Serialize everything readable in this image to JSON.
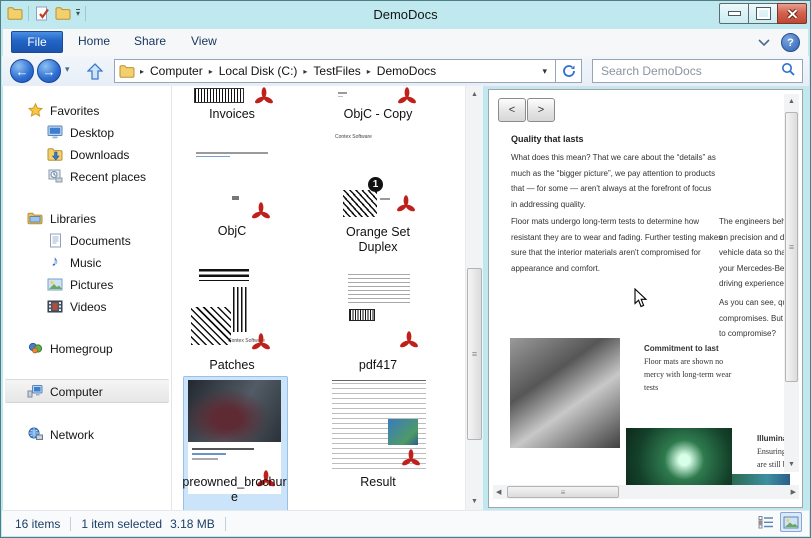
{
  "window": {
    "title": "DemoDocs"
  },
  "icons": {
    "breadcrumb_arrow": "▸",
    "dropdown_arrow": "▾",
    "back_arrow": "←",
    "forward_arrow": "→",
    "scroll_up": "▲",
    "scroll_down": "▼",
    "scroll_left": "◀",
    "scroll_right": "▶",
    "grip": "≡",
    "music_note": "♪",
    "help": "?",
    "close": "✕"
  },
  "ribbon": {
    "tabs": [
      "File",
      "Home",
      "Share",
      "View"
    ]
  },
  "navbar": {
    "breadcrumb": [
      "Computer",
      "Local Disk (C:)",
      "TestFiles",
      "DemoDocs"
    ],
    "search_placeholder": "Search DemoDocs"
  },
  "sidebar": {
    "items": [
      {
        "label": "Favorites"
      },
      {
        "label": "Desktop"
      },
      {
        "label": "Downloads"
      },
      {
        "label": "Recent places"
      },
      {
        "label": "Libraries"
      },
      {
        "label": "Documents"
      },
      {
        "label": "Music"
      },
      {
        "label": "Pictures"
      },
      {
        "label": "Videos"
      },
      {
        "label": "Homegroup"
      },
      {
        "label": "Computer",
        "selected": true
      },
      {
        "label": "Network"
      }
    ]
  },
  "files": {
    "items": [
      {
        "name": "Invoices"
      },
      {
        "name": "ObjC - Copy"
      },
      {
        "name": "ObjC"
      },
      {
        "name": "Orange Set Duplex",
        "badge": "1",
        "thumb_text": "Contex Software"
      },
      {
        "name": "Patches",
        "thumb_text": "Contex Software"
      },
      {
        "name": "pdf417"
      },
      {
        "name": "preowned_brochure",
        "selected": true
      },
      {
        "name": "Result"
      }
    ]
  },
  "preview": {
    "prev": "<",
    "next": ">",
    "heading": "Quality that lasts",
    "para1": "What does this mean? That we care about the “details” as much as the “bigger picture”, we pay attention to products that — for some — aren't always at the forefront of focus in addressing quality.",
    "para2": "Floor mats undergo long-term tests to determine how resistant they are to wear and fading. Further testing makes sure that the interior materials aren't compromised for appearance and comfort.",
    "col2a": [
      "The engineers behin",
      "on precision and de",
      "vehicle data so that",
      "your Mercedes-Ben",
      "driving experience."
    ],
    "col2b": [
      "As you can see, qua",
      "compromises. But w",
      "to compromise?"
    ],
    "caption1_title": "Commitment to last",
    "caption1_body": "Floor mats are shown no mercy with long-term wear tests",
    "caption2_title": "Illuminatin",
    "caption2_lines": [
      "Ensuring t",
      "are still bl"
    ]
  },
  "statusbar": {
    "count": "16 items",
    "selected": "1 item selected",
    "size": "3.18 MB"
  }
}
